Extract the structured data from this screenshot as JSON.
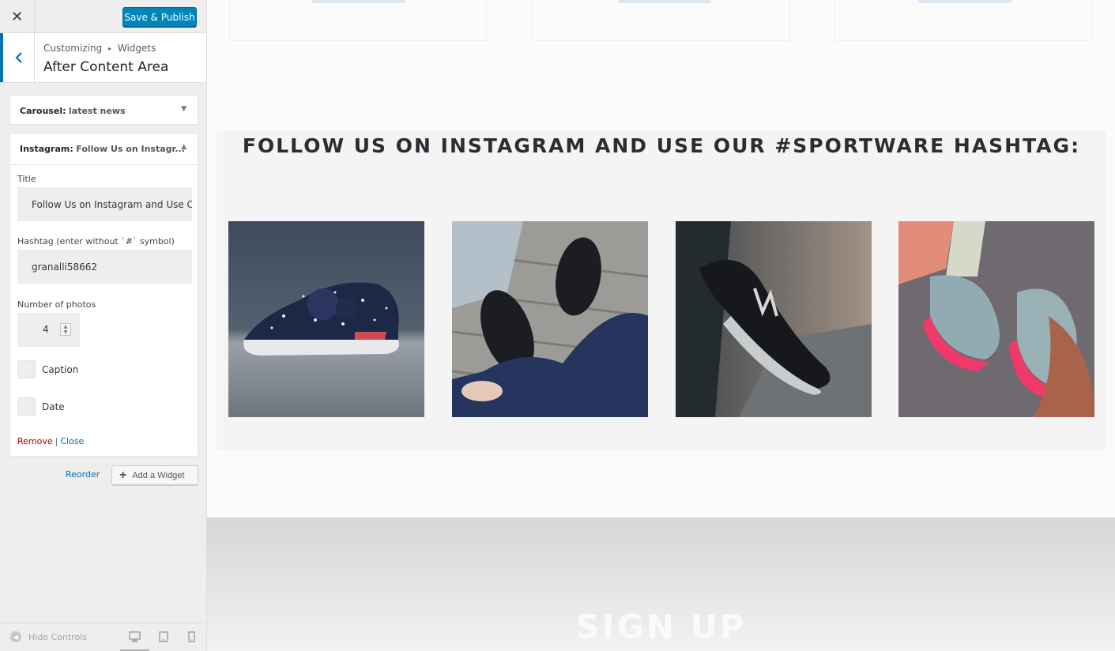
{
  "customizer": {
    "close_symbol": "✕",
    "save_button": "Save & Publish",
    "breadcrumb": {
      "root": "Customizing",
      "separator": "▸",
      "section": "Widgets"
    },
    "section_title": "After Content Area",
    "widgets": [
      {
        "type": "Carousel:",
        "title": "latest news",
        "state": "collapsed"
      },
      {
        "type": "Instagram:",
        "title": "Follow Us on Instagr...",
        "state": "expanded"
      }
    ],
    "instagram_form": {
      "title_label": "Title",
      "title_value": "Follow Us on Instagram and Use C",
      "hashtag_label": "Hashtag (enter without `#` symbol)",
      "hashtag_value": "granalli58662",
      "photos_label": "Number of photos",
      "photos_value": "4",
      "caption_label": "Caption",
      "caption_checked": false,
      "date_label": "Date",
      "date_checked": false,
      "remove_link": "Remove",
      "separator": "|",
      "close_link": "Close"
    },
    "reorder_link": "Reorder",
    "add_widget_button": "Add a Widget",
    "footer": {
      "hide_controls": "Hide Controls",
      "devices": [
        "desktop-icon",
        "tablet-icon",
        "mobile-icon"
      ],
      "active_device": "desktop"
    }
  },
  "preview": {
    "instagram_heading": "FOLLOW US ON INSTAGRAM AND USE OUR #SPORTWARE HASHTAG:",
    "photos": [
      {
        "subject": "sneaker on concrete ledge"
      },
      {
        "subject": "quilted black loafers on wood"
      },
      {
        "subject": "black running shoe against wall"
      },
      {
        "subject": "pink running shoes"
      }
    ],
    "signup_heading": "SIGN UP"
  },
  "colors": {
    "primary_blue": "#0085ba",
    "link_blue": "#0073aa",
    "remove_red": "#aa0000",
    "heading_dark": "#2d2b33"
  }
}
